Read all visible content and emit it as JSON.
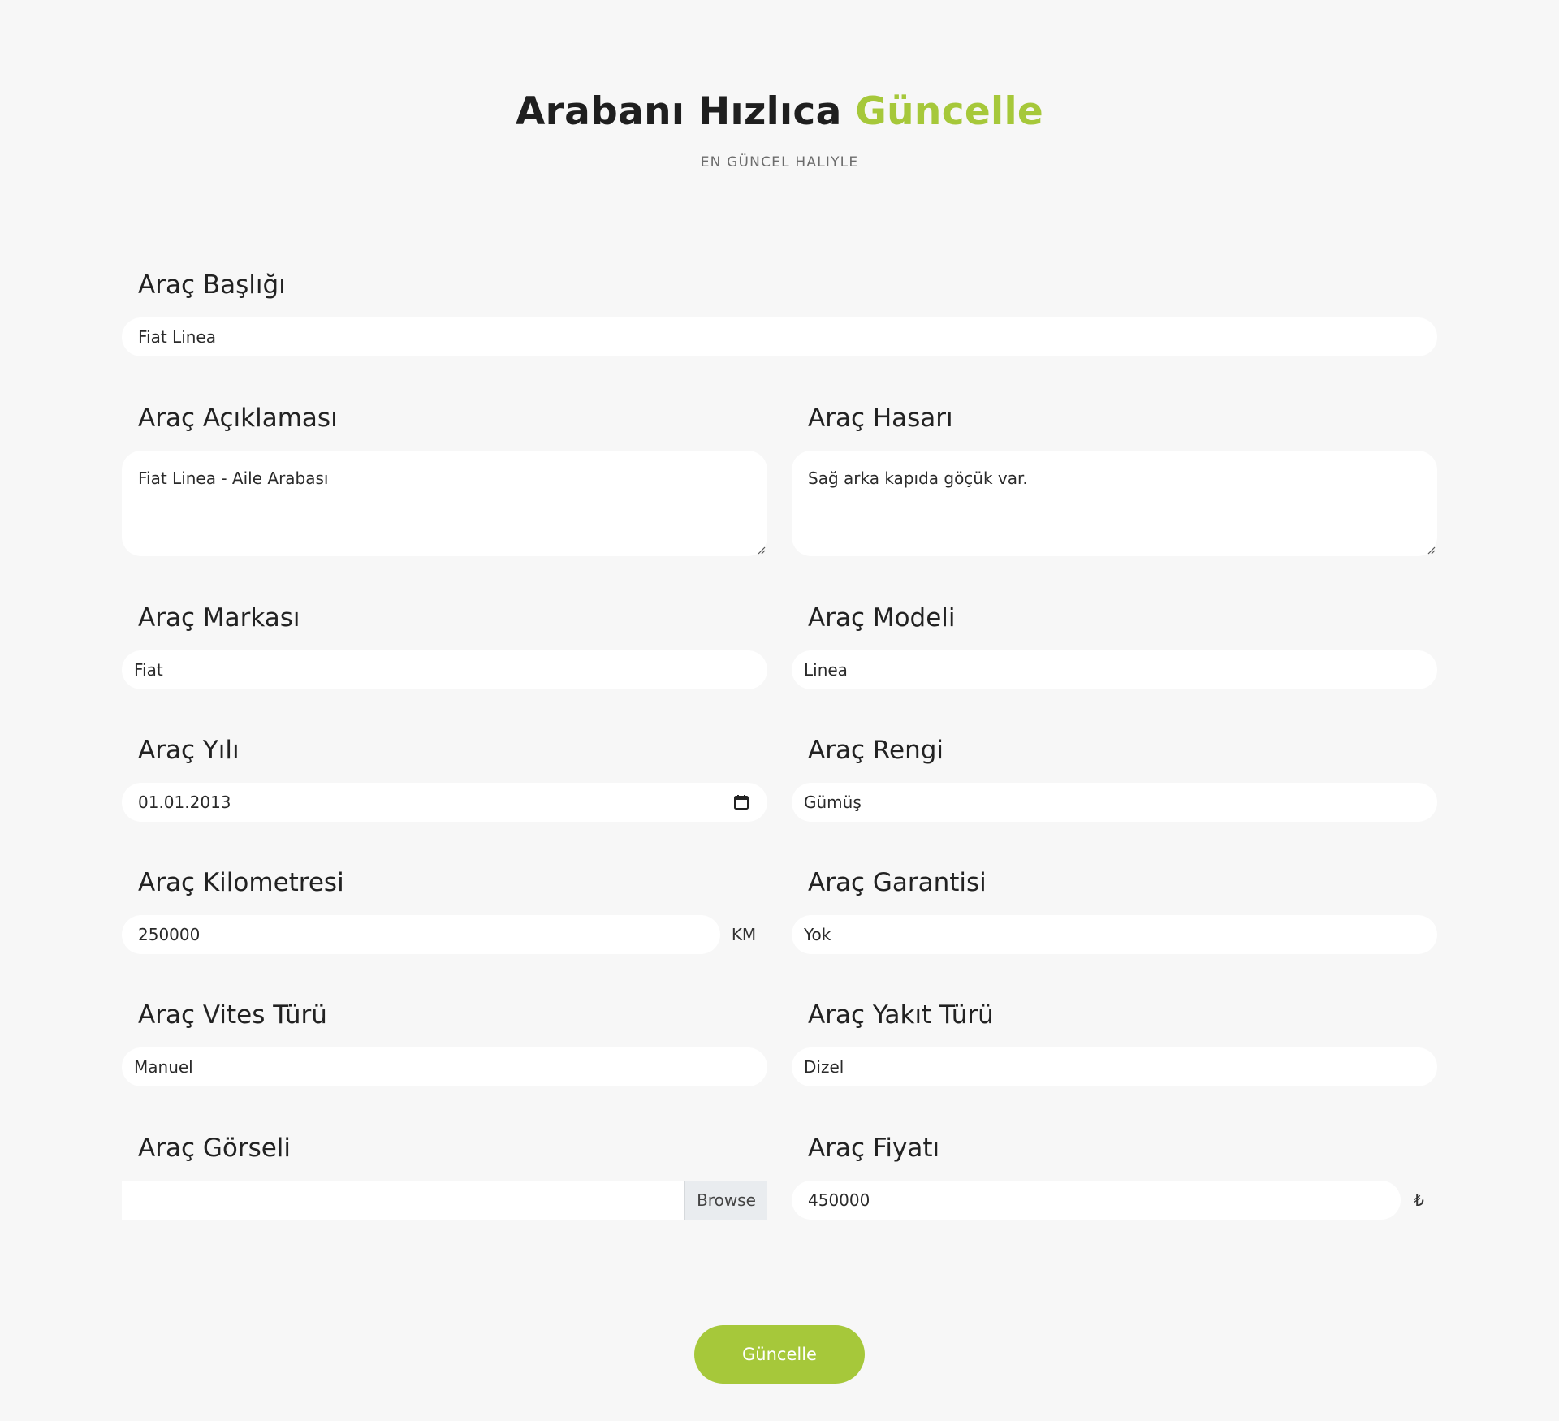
{
  "header": {
    "title_main": "Arabanı Hızlıca",
    "title_accent": "Güncelle",
    "subtitle": "EN GÜNCEL HALIYLE"
  },
  "form": {
    "title": {
      "label": "Araç Başlığı",
      "value": "Fiat Linea"
    },
    "description": {
      "label": "Araç Açıklaması",
      "value": "Fiat Linea - Aile Arabası"
    },
    "damage": {
      "label": "Araç Hasarı",
      "value": "Sağ arka kapıda göçük var."
    },
    "brand": {
      "label": "Araç Markası",
      "value": "Fiat"
    },
    "model": {
      "label": "Araç Modeli",
      "value": "Linea"
    },
    "year": {
      "label": "Araç Yılı",
      "value": "01.01.2013"
    },
    "color": {
      "label": "Araç Rengi",
      "value": "Gümüş"
    },
    "mileage": {
      "label": "Araç Kilometresi",
      "value": "250000",
      "unit": "KM"
    },
    "warranty": {
      "label": "Araç Garantisi",
      "value": "Yok"
    },
    "transmission": {
      "label": "Araç Vites Türü",
      "value": "Manuel"
    },
    "fuel": {
      "label": "Araç Yakıt Türü",
      "value": "Dizel"
    },
    "image": {
      "label": "Araç Görseli",
      "value": "",
      "browse_label": "Browse"
    },
    "price": {
      "label": "Araç Fiyatı",
      "value": "450000",
      "currency": "₺"
    },
    "submit_label": "Güncelle"
  },
  "icons": {
    "calendar": "calendar-icon",
    "resize": "resize-grip-icon"
  },
  "colors": {
    "accent": "#a6c83a",
    "background": "#f7f7f7",
    "input_bg": "#ffffff"
  }
}
